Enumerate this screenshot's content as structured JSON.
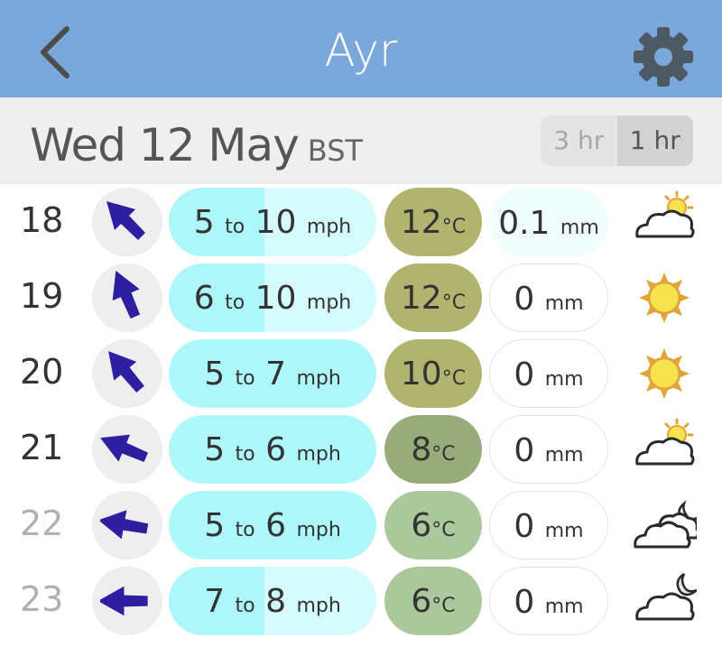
{
  "header": {
    "title": "Ayr",
    "back_icon": "chevron-left-icon",
    "settings_icon": "gear-icon",
    "color": "#7aa8da"
  },
  "date_bar": {
    "date": "Wed 12 May",
    "timezone": "BST",
    "interval_options": [
      "3 hr",
      "1 hr"
    ],
    "selected_interval": "1 hr"
  },
  "forecast": [
    {
      "hour": "18",
      "wind_from": "5",
      "wind_to": "10",
      "wind_unit": "mph",
      "wind_sep": "to",
      "temp": "12",
      "temp_unit": "°C",
      "rain": "0.1",
      "rain_unit": "mm",
      "weather_icon": "partly-cloudy-sun-icon",
      "temp_color": "#b0b46e"
    },
    {
      "hour": "19",
      "wind_from": "6",
      "wind_to": "10",
      "wind_unit": "mph",
      "wind_sep": "to",
      "temp": "12",
      "temp_unit": "°C",
      "rain": "0",
      "rain_unit": "mm",
      "weather_icon": "sun-icon",
      "temp_color": "#b0b46e"
    },
    {
      "hour": "20",
      "wind_from": "5",
      "wind_to": "7",
      "wind_unit": "mph",
      "wind_sep": "to",
      "temp": "10",
      "temp_unit": "°C",
      "rain": "0",
      "rain_unit": "mm",
      "weather_icon": "sun-icon",
      "temp_color": "#b0b46e"
    },
    {
      "hour": "21",
      "wind_from": "5",
      "wind_to": "6",
      "wind_unit": "mph",
      "wind_sep": "to",
      "temp": "8",
      "temp_unit": "°C",
      "rain": "0",
      "rain_unit": "mm",
      "weather_icon": "partly-cloudy-sun-icon",
      "temp_color": "#98ac7a"
    },
    {
      "hour": "22",
      "wind_from": "5",
      "wind_to": "6",
      "wind_unit": "mph",
      "wind_sep": "to",
      "temp": "6",
      "temp_unit": "°C",
      "rain": "0",
      "rain_unit": "mm",
      "weather_icon": "cloudy-night-icon",
      "temp_color": "#aac89c"
    },
    {
      "hour": "23",
      "wind_from": "7",
      "wind_to": "8",
      "wind_unit": "mph",
      "wind_sep": "to",
      "temp": "6",
      "temp_unit": "°C",
      "rain": "0",
      "rain_unit": "mm",
      "weather_icon": "partly-cloudy-moon-icon",
      "temp_color": "#aac89c"
    }
  ]
}
